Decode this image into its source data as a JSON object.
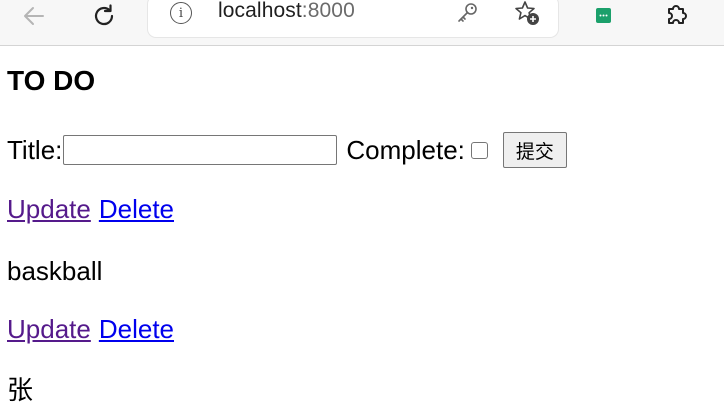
{
  "browser": {
    "url_host": "localhost",
    "url_port": ":8000",
    "icons": [
      "back-icon",
      "refresh-icon",
      "info-icon",
      "key-icon",
      "favorite-add-icon",
      "extension-badge-icon",
      "extensions-puzzle-icon"
    ]
  },
  "page": {
    "heading": "TO DO",
    "form": {
      "title_label": "Title:",
      "title_value": "",
      "complete_label": "Complete:",
      "complete_checked": false,
      "submit_label": "提交"
    },
    "items": [
      {
        "update_label": "Update",
        "delete_label": "Delete",
        "title": "baskball"
      },
      {
        "update_label": "Update",
        "delete_label": "Delete",
        "title": "张"
      }
    ]
  },
  "colors": {
    "link": "#0000ee",
    "link_visited": "#551a8b",
    "extension_green": "#1ba06b"
  }
}
